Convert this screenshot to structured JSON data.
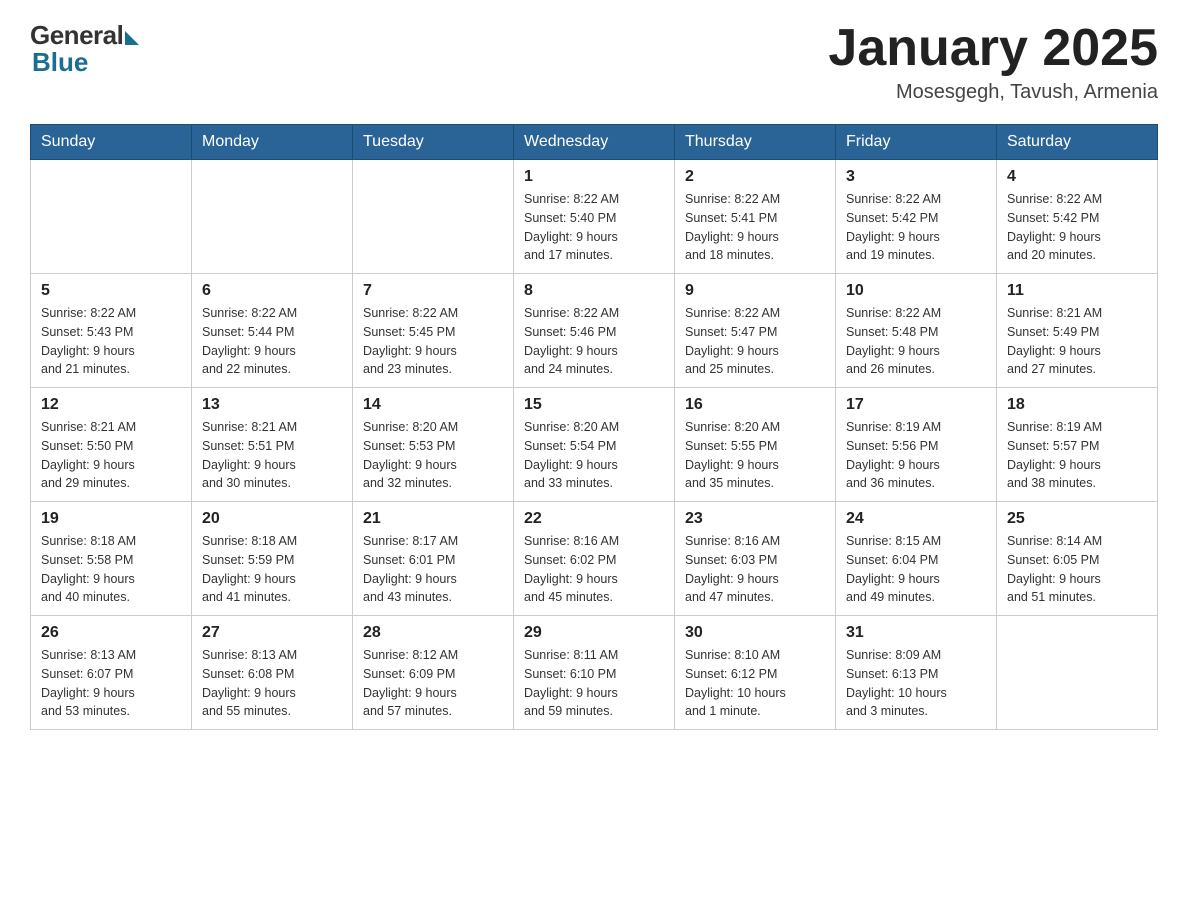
{
  "header": {
    "logo_general": "General",
    "logo_blue": "Blue",
    "month_title": "January 2025",
    "location": "Mosesgegh, Tavush, Armenia"
  },
  "weekdays": [
    "Sunday",
    "Monday",
    "Tuesday",
    "Wednesday",
    "Thursday",
    "Friday",
    "Saturday"
  ],
  "weeks": [
    [
      {
        "day": "",
        "info": ""
      },
      {
        "day": "",
        "info": ""
      },
      {
        "day": "",
        "info": ""
      },
      {
        "day": "1",
        "info": "Sunrise: 8:22 AM\nSunset: 5:40 PM\nDaylight: 9 hours\nand 17 minutes."
      },
      {
        "day": "2",
        "info": "Sunrise: 8:22 AM\nSunset: 5:41 PM\nDaylight: 9 hours\nand 18 minutes."
      },
      {
        "day": "3",
        "info": "Sunrise: 8:22 AM\nSunset: 5:42 PM\nDaylight: 9 hours\nand 19 minutes."
      },
      {
        "day": "4",
        "info": "Sunrise: 8:22 AM\nSunset: 5:42 PM\nDaylight: 9 hours\nand 20 minutes."
      }
    ],
    [
      {
        "day": "5",
        "info": "Sunrise: 8:22 AM\nSunset: 5:43 PM\nDaylight: 9 hours\nand 21 minutes."
      },
      {
        "day": "6",
        "info": "Sunrise: 8:22 AM\nSunset: 5:44 PM\nDaylight: 9 hours\nand 22 minutes."
      },
      {
        "day": "7",
        "info": "Sunrise: 8:22 AM\nSunset: 5:45 PM\nDaylight: 9 hours\nand 23 minutes."
      },
      {
        "day": "8",
        "info": "Sunrise: 8:22 AM\nSunset: 5:46 PM\nDaylight: 9 hours\nand 24 minutes."
      },
      {
        "day": "9",
        "info": "Sunrise: 8:22 AM\nSunset: 5:47 PM\nDaylight: 9 hours\nand 25 minutes."
      },
      {
        "day": "10",
        "info": "Sunrise: 8:22 AM\nSunset: 5:48 PM\nDaylight: 9 hours\nand 26 minutes."
      },
      {
        "day": "11",
        "info": "Sunrise: 8:21 AM\nSunset: 5:49 PM\nDaylight: 9 hours\nand 27 minutes."
      }
    ],
    [
      {
        "day": "12",
        "info": "Sunrise: 8:21 AM\nSunset: 5:50 PM\nDaylight: 9 hours\nand 29 minutes."
      },
      {
        "day": "13",
        "info": "Sunrise: 8:21 AM\nSunset: 5:51 PM\nDaylight: 9 hours\nand 30 minutes."
      },
      {
        "day": "14",
        "info": "Sunrise: 8:20 AM\nSunset: 5:53 PM\nDaylight: 9 hours\nand 32 minutes."
      },
      {
        "day": "15",
        "info": "Sunrise: 8:20 AM\nSunset: 5:54 PM\nDaylight: 9 hours\nand 33 minutes."
      },
      {
        "day": "16",
        "info": "Sunrise: 8:20 AM\nSunset: 5:55 PM\nDaylight: 9 hours\nand 35 minutes."
      },
      {
        "day": "17",
        "info": "Sunrise: 8:19 AM\nSunset: 5:56 PM\nDaylight: 9 hours\nand 36 minutes."
      },
      {
        "day": "18",
        "info": "Sunrise: 8:19 AM\nSunset: 5:57 PM\nDaylight: 9 hours\nand 38 minutes."
      }
    ],
    [
      {
        "day": "19",
        "info": "Sunrise: 8:18 AM\nSunset: 5:58 PM\nDaylight: 9 hours\nand 40 minutes."
      },
      {
        "day": "20",
        "info": "Sunrise: 8:18 AM\nSunset: 5:59 PM\nDaylight: 9 hours\nand 41 minutes."
      },
      {
        "day": "21",
        "info": "Sunrise: 8:17 AM\nSunset: 6:01 PM\nDaylight: 9 hours\nand 43 minutes."
      },
      {
        "day": "22",
        "info": "Sunrise: 8:16 AM\nSunset: 6:02 PM\nDaylight: 9 hours\nand 45 minutes."
      },
      {
        "day": "23",
        "info": "Sunrise: 8:16 AM\nSunset: 6:03 PM\nDaylight: 9 hours\nand 47 minutes."
      },
      {
        "day": "24",
        "info": "Sunrise: 8:15 AM\nSunset: 6:04 PM\nDaylight: 9 hours\nand 49 minutes."
      },
      {
        "day": "25",
        "info": "Sunrise: 8:14 AM\nSunset: 6:05 PM\nDaylight: 9 hours\nand 51 minutes."
      }
    ],
    [
      {
        "day": "26",
        "info": "Sunrise: 8:13 AM\nSunset: 6:07 PM\nDaylight: 9 hours\nand 53 minutes."
      },
      {
        "day": "27",
        "info": "Sunrise: 8:13 AM\nSunset: 6:08 PM\nDaylight: 9 hours\nand 55 minutes."
      },
      {
        "day": "28",
        "info": "Sunrise: 8:12 AM\nSunset: 6:09 PM\nDaylight: 9 hours\nand 57 minutes."
      },
      {
        "day": "29",
        "info": "Sunrise: 8:11 AM\nSunset: 6:10 PM\nDaylight: 9 hours\nand 59 minutes."
      },
      {
        "day": "30",
        "info": "Sunrise: 8:10 AM\nSunset: 6:12 PM\nDaylight: 10 hours\nand 1 minute."
      },
      {
        "day": "31",
        "info": "Sunrise: 8:09 AM\nSunset: 6:13 PM\nDaylight: 10 hours\nand 3 minutes."
      },
      {
        "day": "",
        "info": ""
      }
    ]
  ]
}
